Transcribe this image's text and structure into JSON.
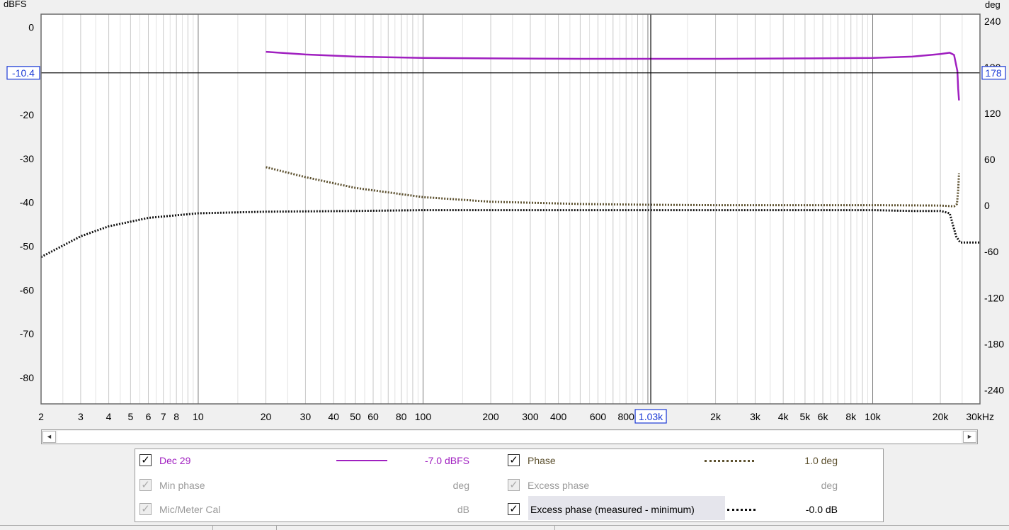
{
  "chart_data": {
    "type": "line",
    "x_scale": "log",
    "xlim": [
      2,
      30000
    ],
    "ylim_left": [
      -86,
      3
    ],
    "ylim_right": [
      -258,
      249
    ],
    "ylabel_left": "dBFS",
    "ylabel_right": "deg",
    "grid": true,
    "x_ticks": [
      {
        "v": 2,
        "t": "2"
      },
      {
        "v": 3,
        "t": "3"
      },
      {
        "v": 4,
        "t": "4"
      },
      {
        "v": 5,
        "t": "5"
      },
      {
        "v": 6,
        "t": "6"
      },
      {
        "v": 7,
        "t": "7"
      },
      {
        "v": 8,
        "t": "8"
      },
      {
        "v": 10,
        "t": "10"
      },
      {
        "v": 20,
        "t": "20"
      },
      {
        "v": 30,
        "t": "30"
      },
      {
        "v": 40,
        "t": "40"
      },
      {
        "v": 50,
        "t": "50"
      },
      {
        "v": 60,
        "t": "60"
      },
      {
        "v": 80,
        "t": "80"
      },
      {
        "v": 100,
        "t": "100"
      },
      {
        "v": 200,
        "t": "200"
      },
      {
        "v": 300,
        "t": "300"
      },
      {
        "v": 400,
        "t": "400"
      },
      {
        "v": 600,
        "t": "600"
      },
      {
        "v": 800,
        "t": "800"
      },
      {
        "v": 2000,
        "t": "2k"
      },
      {
        "v": 3000,
        "t": "3k"
      },
      {
        "v": 4000,
        "t": "4k"
      },
      {
        "v": 5000,
        "t": "5k"
      },
      {
        "v": 6000,
        "t": "6k"
      },
      {
        "v": 8000,
        "t": "8k"
      },
      {
        "v": 10000,
        "t": "10k"
      },
      {
        "v": 20000,
        "t": "20k"
      },
      {
        "v": 30000,
        "t": "30kHz"
      }
    ],
    "y_ticks_left": [
      0,
      -10,
      -20,
      -30,
      -40,
      -50,
      -60,
      -70,
      -80
    ],
    "y_ticks_right": [
      240,
      180,
      120,
      60,
      0,
      -60,
      -120,
      -180,
      -240
    ],
    "cursor": {
      "x": 1030,
      "x_label": "1.03k",
      "y_left": -10.4,
      "y_left_label": "-10.4",
      "y_right_label": "178"
    },
    "series": [
      {
        "name": "Dec 29",
        "axis": "left",
        "color": "#a020c0",
        "style": "solid",
        "x": [
          20,
          30,
          50,
          100,
          200,
          500,
          1000,
          2000,
          5000,
          10000,
          15000,
          20000,
          22000,
          23000,
          23800,
          24000,
          24200
        ],
        "y": [
          -5.6,
          -6.2,
          -6.7,
          -7.0,
          -7.1,
          -7.2,
          -7.2,
          -7.2,
          -7.1,
          -7.0,
          -6.7,
          -6.1,
          -5.8,
          -6.3,
          -10.0,
          -14.0,
          -16.7
        ]
      },
      {
        "name": "Phase",
        "axis": "right",
        "color": "#5e5230",
        "style": "dotted",
        "x": [
          20,
          30,
          50,
          100,
          200,
          500,
          1000,
          2000,
          5000,
          10000,
          20000,
          23000,
          23700,
          24000,
          24200
        ],
        "y": [
          50,
          37,
          23,
          11,
          5,
          2,
          1,
          0.5,
          0.5,
          0.5,
          0,
          -1,
          2,
          20,
          42
        ]
      },
      {
        "name": "Excess phase (measured - minimum)",
        "axis": "right",
        "color": "#111111",
        "style": "dotted",
        "x": [
          2,
          3,
          4,
          6,
          10,
          20,
          50,
          100,
          1000,
          10000,
          15000,
          20000,
          22000,
          23500,
          24500,
          26000,
          30000
        ],
        "y": [
          -67,
          -40,
          -27,
          -16,
          -10,
          -8,
          -7,
          -6,
          -6,
          -6,
          -7,
          -7,
          -10,
          -40,
          -48,
          -48,
          -48
        ]
      }
    ]
  },
  "scrollbar": {
    "left_arrow": "◄",
    "right_arrow": "►"
  },
  "legend": {
    "dec29": {
      "label": "Dec 29",
      "value": "-7.0 dBFS",
      "color": "#a020c0"
    },
    "phase": {
      "label": "Phase",
      "value": "1.0 deg",
      "color": "#5e5230"
    },
    "min_phase": {
      "label": "Min phase",
      "value": "deg"
    },
    "excess_phase": {
      "label": "Excess phase",
      "value": "deg"
    },
    "mic_cal": {
      "label": "Mic/Meter Cal",
      "value": "dB"
    },
    "excess_measured": {
      "label": "Excess phase (measured - minimum)",
      "value": "-0.0 dB"
    },
    "check": "✓"
  }
}
